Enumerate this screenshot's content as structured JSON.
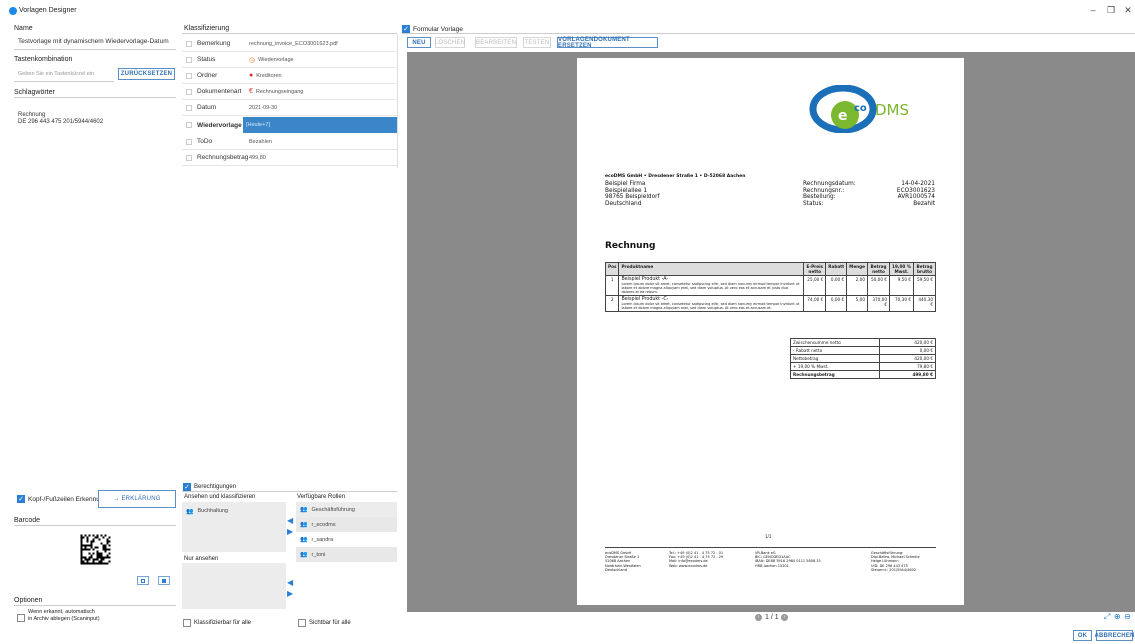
{
  "window": {
    "title": "Vorlagen Designer",
    "minimize": "–",
    "maximize": "❐",
    "close": "✕"
  },
  "left": {
    "name_label": "Name",
    "name_value": "Testvorlage mit dynamischem Wiedervorlage-Datum",
    "shortcut_label": "Tastenkombination",
    "shortcut_placeholder": "Geben Sie ein Tastenkürzel ein",
    "reset_button": "ZURÜCKSETZEN",
    "keywords_label": "Schlagwörter",
    "keywords_line1": "Rechnung",
    "keywords_line2": "DE 296 443 475 201/5944/4602",
    "header_footer_label": "Kopf-/Fußzeilen Erkennung",
    "explain_button": "→ ERKLÄRUNG",
    "barcode_label": "Barcode",
    "options_label": "Optionen",
    "option_line1": "Wenn erkannt, automatisch",
    "option_line2": "in Archiv ablegen (Scaninput)"
  },
  "classification": {
    "header": "Klassifizierung",
    "rows": [
      {
        "key": "Bemerkung",
        "value": "rechnung_invoice_ECO3001623.pdf",
        "icon": ""
      },
      {
        "key": "Status",
        "value": "Wiedervorlage",
        "icon": "clock-icon"
      },
      {
        "key": "Ordner",
        "value": "Kreditoren",
        "icon": "folder-icon"
      },
      {
        "key": "Dokumentenart",
        "value": "Rechnungseingang",
        "icon": "euro-icon"
      },
      {
        "key": "Datum",
        "value": "2021-09-30",
        "icon": ""
      },
      {
        "key": "Wiedervorlage ab",
        "value": "[Heute+7]",
        "icon": ""
      },
      {
        "key": "ToDo",
        "value": "Bezahlen",
        "icon": ""
      },
      {
        "key": "Rechnungsbetrag",
        "value": "499,80",
        "icon": ""
      }
    ],
    "permissions_label": "Berechtigungen",
    "view_classify_label": "Ansehen und klassifizieren",
    "view_classify_roles": [
      "Buchhaltung"
    ],
    "view_only_label": "Nur ansehen",
    "available_roles_label": "Verfügbare Rollen",
    "available_roles": [
      "Geschäftsführung",
      "r_ecodms",
      "r_sandra",
      "r_toni"
    ],
    "classifiable_all": "Klassifizierbar für alle",
    "visible_all": "Sichtbar für alle"
  },
  "form": {
    "form_template_label": "Formular Vorlage",
    "buttons": {
      "new": "NEU",
      "delete": "LÖSCHEN",
      "edit": "BEARBEITEN",
      "test": "TESTEN",
      "replace": "VORLAGENDOKUMENT ERSETZEN"
    },
    "page_indicator": "1 / 1",
    "ok": "OK",
    "cancel": "ABBRECHEN"
  },
  "document": {
    "logo_text_eco": "co",
    "logo_text_dms": "DMS",
    "sender_line": "ecoDMS GmbH • Dresdener Straße 1 • D-52068 Aachen",
    "recipient": [
      "Beispiel Firma",
      "Beispielallee 1",
      "98765 Beispieldorf",
      "Deutschland"
    ],
    "meta_labels": [
      "Rechnungsdatum:",
      "Rechnungsnr.:",
      "Bestellung:",
      "Status:"
    ],
    "meta_values": [
      "14-04-2021",
      "ECO3001623",
      "AVR1000574",
      "Bezahlt"
    ],
    "title": "Rechnung",
    "table_headers": [
      "Pos",
      "Produktname",
      "E-Preis netto",
      "Rabatt",
      "Menge",
      "Betrag netto",
      "19,00 % Mwst.",
      "Betrag brutto"
    ],
    "items": [
      {
        "pos": "1",
        "name": "Beispiel Produkt -A-",
        "desc": "Lorem ipsum dolor sit amet, consetetur sadipscing elitr, sed diam nonumy eirmod tempor invidunt ut labore et dolore magna aliquyam erat, sed diam voluptua. At vero eos et accusam et justo duo dolores et ea rebum.",
        "price": "25,00 €",
        "discount": "0,00 €",
        "qty": "2,00",
        "net": "50,00 €",
        "vat": "9,50 €",
        "gross": "59,50 €"
      },
      {
        "pos": "2",
        "name": "Beispiel Produkt -C-",
        "desc": "Lorem ipsum dolor sit amet, consetetur sadipscing elitr, sed diam nonumy eirmod tempor invidunt ut labore et dolore magna aliquyam erat, sed diam voluptua. At vero eos et accusam et.",
        "price": "74,00 €",
        "discount": "0,00 €",
        "qty": "5,00",
        "net": "370,00 €",
        "vat": "70,30 €",
        "gross": "440,30 €"
      }
    ],
    "totals": [
      {
        "label": "Zwischensumme netto",
        "value": "420,00 €"
      },
      {
        "label": "- Rabatt netto",
        "value": "0,00 €"
      },
      {
        "label": "Nettobetrag",
        "value": "420,00 €"
      },
      {
        "label": "+ 19,00 % Mwst.",
        "value": "79,80 €"
      },
      {
        "label": "Rechnungsbetrag",
        "value": "499,80 €"
      }
    ],
    "page_number": "1/1",
    "footer_cols": [
      [
        "ecoDMS GmbH",
        "Dresdener Straße 1",
        "52068 Aachen",
        "Nordrhein-Westfalen",
        "Deutschland"
      ],
      [
        "Tel.: +49 (0)2 41 - 4 75 72 - 01",
        "Fax: +49 (0)2 41 - 4 75 72 - 29",
        "Mail: info@ecodms.de",
        "Web: www.ecodms.de"
      ],
      [
        "VR-Bank eG",
        "BIC: GENODED1AAC",
        "IBAN: DE88 3916 2980 0111 5858 15",
        "HRB Aachen 15201"
      ],
      [
        "Geschäftsführung:",
        "Dipl-Betrw. Michael Schmitz",
        "Helge Lühmann",
        "UID: DE 296 443 475",
        "Steuernr.: 201/5944/4602"
      ]
    ]
  }
}
